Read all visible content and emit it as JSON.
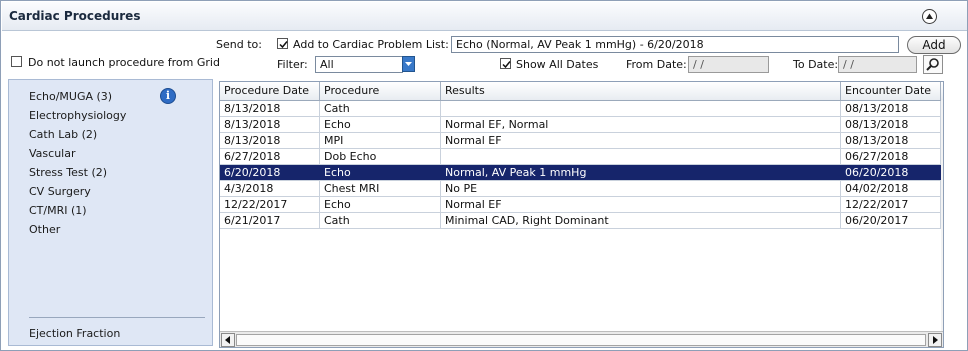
{
  "header": {
    "title": "Cardiac Procedures"
  },
  "controls": {
    "send_to_label": "Send to:",
    "add_to_list_label": "Add to Cardiac Problem List:",
    "add_to_list_checked": true,
    "problem_text": "Echo (Normal, AV Peak 1 mmHg) - 6/20/2018",
    "add_button": "Add",
    "no_launch_label": "Do not launch procedure from Grid",
    "no_launch_checked": false,
    "filter_label": "Filter:",
    "filter_value": "All",
    "show_all_dates_label": "Show All Dates",
    "show_all_dates_checked": true,
    "from_date_label": "From Date:",
    "from_date_value": "/ /",
    "to_date_label": "To Date:",
    "to_date_value": "/ /"
  },
  "categories": [
    {
      "label": "Echo/MUGA",
      "count": "(3)"
    },
    {
      "label": "Electrophysiology",
      "count": ""
    },
    {
      "label": "Cath Lab",
      "count": "(2)"
    },
    {
      "label": "Vascular",
      "count": ""
    },
    {
      "label": "Stress Test",
      "count": "(2)"
    },
    {
      "label": "CV Surgery",
      "count": ""
    },
    {
      "label": "CT/MRI",
      "count": "(1)"
    },
    {
      "label": "Other",
      "count": ""
    }
  ],
  "ejection_fraction_label": "Ejection Fraction",
  "grid": {
    "columns": [
      "Procedure Date",
      "Procedure",
      "Results",
      "Encounter Date"
    ],
    "selected_index": 4,
    "rows": [
      [
        "8/13/2018",
        "Cath",
        "",
        "08/13/2018"
      ],
      [
        "8/13/2018",
        "Echo",
        "Normal EF, Normal",
        "08/13/2018"
      ],
      [
        "8/13/2018",
        "MPI",
        "Normal EF",
        "08/13/2018"
      ],
      [
        "6/27/2018",
        "Dob Echo",
        "",
        "06/27/2018"
      ],
      [
        "6/20/2018",
        "Echo",
        "Normal, AV Peak 1 mmHg",
        "06/20/2018"
      ],
      [
        "4/3/2018",
        "Chest MRI",
        "No PE",
        "04/02/2018"
      ],
      [
        "12/22/2017",
        "Echo",
        "Normal EF",
        "12/22/2017"
      ],
      [
        "6/21/2017",
        "Cath",
        "Minimal CAD, Right Dominant",
        "06/20/2017"
      ]
    ]
  }
}
